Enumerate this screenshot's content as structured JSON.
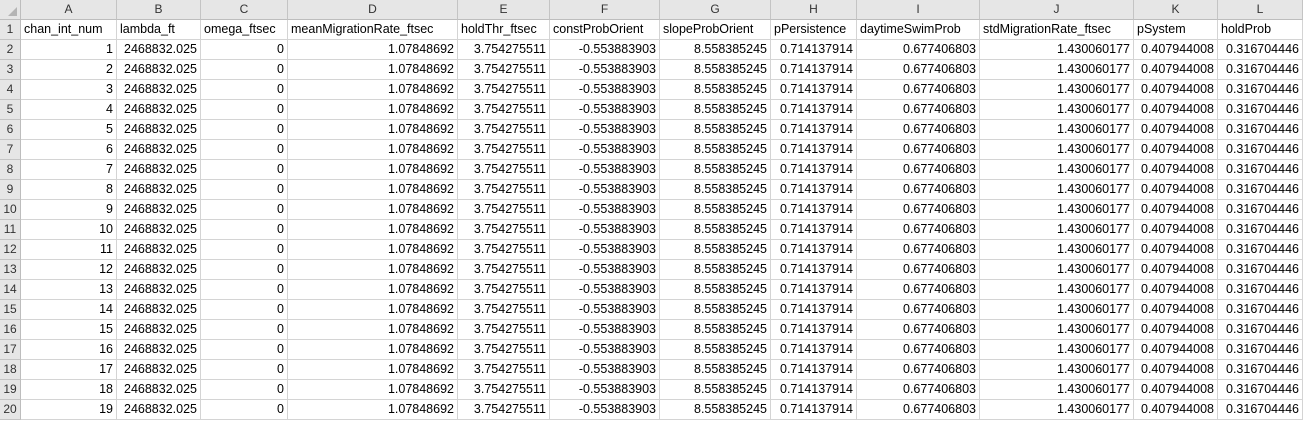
{
  "columns": [
    "A",
    "B",
    "C",
    "D",
    "E",
    "F",
    "G",
    "H",
    "I",
    "J",
    "K",
    "L"
  ],
  "header_row": [
    "chan_int_num",
    "lambda_ft",
    "omega_ftsec",
    "meanMigrationRate_ftsec",
    "holdThr_ftsec",
    "constProbOrient",
    "slopeProbOrient",
    "pPersistence",
    "daytimeSwimProb",
    "stdMigrationRate_ftsec",
    "pSystem",
    "holdProb"
  ],
  "row_numbers": [
    "1",
    "2",
    "3",
    "4",
    "5",
    "6",
    "7",
    "8",
    "9",
    "10",
    "11",
    "12",
    "13",
    "14",
    "15",
    "16",
    "17",
    "18",
    "19",
    "20"
  ],
  "rows": [
    [
      "1",
      "2468832.025",
      "0",
      "1.07848692",
      "3.754275511",
      "-0.553883903",
      "8.558385245",
      "0.714137914",
      "0.677406803",
      "1.430060177",
      "0.407944008",
      "0.316704446"
    ],
    [
      "2",
      "2468832.025",
      "0",
      "1.07848692",
      "3.754275511",
      "-0.553883903",
      "8.558385245",
      "0.714137914",
      "0.677406803",
      "1.430060177",
      "0.407944008",
      "0.316704446"
    ],
    [
      "3",
      "2468832.025",
      "0",
      "1.07848692",
      "3.754275511",
      "-0.553883903",
      "8.558385245",
      "0.714137914",
      "0.677406803",
      "1.430060177",
      "0.407944008",
      "0.316704446"
    ],
    [
      "4",
      "2468832.025",
      "0",
      "1.07848692",
      "3.754275511",
      "-0.553883903",
      "8.558385245",
      "0.714137914",
      "0.677406803",
      "1.430060177",
      "0.407944008",
      "0.316704446"
    ],
    [
      "5",
      "2468832.025",
      "0",
      "1.07848692",
      "3.754275511",
      "-0.553883903",
      "8.558385245",
      "0.714137914",
      "0.677406803",
      "1.430060177",
      "0.407944008",
      "0.316704446"
    ],
    [
      "6",
      "2468832.025",
      "0",
      "1.07848692",
      "3.754275511",
      "-0.553883903",
      "8.558385245",
      "0.714137914",
      "0.677406803",
      "1.430060177",
      "0.407944008",
      "0.316704446"
    ],
    [
      "7",
      "2468832.025",
      "0",
      "1.07848692",
      "3.754275511",
      "-0.553883903",
      "8.558385245",
      "0.714137914",
      "0.677406803",
      "1.430060177",
      "0.407944008",
      "0.316704446"
    ],
    [
      "8",
      "2468832.025",
      "0",
      "1.07848692",
      "3.754275511",
      "-0.553883903",
      "8.558385245",
      "0.714137914",
      "0.677406803",
      "1.430060177",
      "0.407944008",
      "0.316704446"
    ],
    [
      "9",
      "2468832.025",
      "0",
      "1.07848692",
      "3.754275511",
      "-0.553883903",
      "8.558385245",
      "0.714137914",
      "0.677406803",
      "1.430060177",
      "0.407944008",
      "0.316704446"
    ],
    [
      "10",
      "2468832.025",
      "0",
      "1.07848692",
      "3.754275511",
      "-0.553883903",
      "8.558385245",
      "0.714137914",
      "0.677406803",
      "1.430060177",
      "0.407944008",
      "0.316704446"
    ],
    [
      "11",
      "2468832.025",
      "0",
      "1.07848692",
      "3.754275511",
      "-0.553883903",
      "8.558385245",
      "0.714137914",
      "0.677406803",
      "1.430060177",
      "0.407944008",
      "0.316704446"
    ],
    [
      "12",
      "2468832.025",
      "0",
      "1.07848692",
      "3.754275511",
      "-0.553883903",
      "8.558385245",
      "0.714137914",
      "0.677406803",
      "1.430060177",
      "0.407944008",
      "0.316704446"
    ],
    [
      "13",
      "2468832.025",
      "0",
      "1.07848692",
      "3.754275511",
      "-0.553883903",
      "8.558385245",
      "0.714137914",
      "0.677406803",
      "1.430060177",
      "0.407944008",
      "0.316704446"
    ],
    [
      "14",
      "2468832.025",
      "0",
      "1.07848692",
      "3.754275511",
      "-0.553883903",
      "8.558385245",
      "0.714137914",
      "0.677406803",
      "1.430060177",
      "0.407944008",
      "0.316704446"
    ],
    [
      "15",
      "2468832.025",
      "0",
      "1.07848692",
      "3.754275511",
      "-0.553883903",
      "8.558385245",
      "0.714137914",
      "0.677406803",
      "1.430060177",
      "0.407944008",
      "0.316704446"
    ],
    [
      "16",
      "2468832.025",
      "0",
      "1.07848692",
      "3.754275511",
      "-0.553883903",
      "8.558385245",
      "0.714137914",
      "0.677406803",
      "1.430060177",
      "0.407944008",
      "0.316704446"
    ],
    [
      "17",
      "2468832.025",
      "0",
      "1.07848692",
      "3.754275511",
      "-0.553883903",
      "8.558385245",
      "0.714137914",
      "0.677406803",
      "1.430060177",
      "0.407944008",
      "0.316704446"
    ],
    [
      "18",
      "2468832.025",
      "0",
      "1.07848692",
      "3.754275511",
      "-0.553883903",
      "8.558385245",
      "0.714137914",
      "0.677406803",
      "1.430060177",
      "0.407944008",
      "0.316704446"
    ],
    [
      "19",
      "2468832.025",
      "0",
      "1.07848692",
      "3.754275511",
      "-0.553883903",
      "8.558385245",
      "0.714137914",
      "0.677406803",
      "1.430060177",
      "0.407944008",
      "0.316704446"
    ]
  ]
}
